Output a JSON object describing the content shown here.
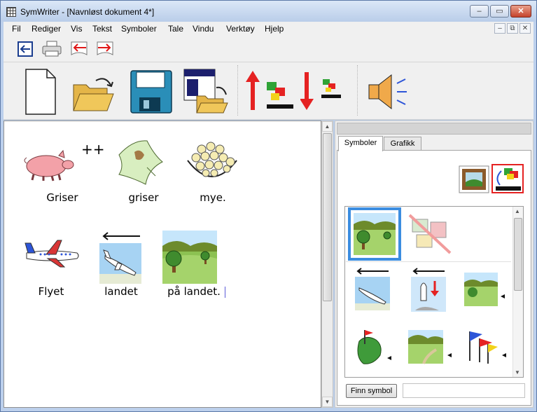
{
  "window": {
    "title": "SymWriter - [Navnløst dokument 4*]",
    "minimize": "–",
    "maximize": "▭",
    "close": "✕"
  },
  "menu": {
    "items": [
      "Fil",
      "Rediger",
      "Vis",
      "Tekst",
      "Symboler",
      "Tale",
      "Vindu",
      "Verktøy",
      "Hjelp"
    ],
    "mdi_min": "–",
    "mdi_restore": "⧉",
    "mdi_close": "✕"
  },
  "toolbar_small": {
    "icons": [
      "exit-icon",
      "print-icon",
      "undo-icon",
      "redo-icon"
    ]
  },
  "toolbar_large": {
    "icons": [
      "new-document-icon",
      "open-folder-icon",
      "save-disk-icon",
      "open-template-icon",
      "symbol-up-icon",
      "symbol-down-icon",
      "speaker-icon"
    ]
  },
  "document": {
    "words": [
      {
        "text": "Griser",
        "symbol": "pig-plural"
      },
      {
        "text": "griser",
        "symbol": "messy-cloth"
      },
      {
        "text": "mye.",
        "symbol": "many-balls"
      },
      {
        "text": "Flyet",
        "symbol": "airplane"
      },
      {
        "text": "landet",
        "symbol": "plane-landing"
      },
      {
        "text": "på landet.",
        "symbol": "countryside"
      }
    ]
  },
  "panel": {
    "tabs": [
      "Symboler",
      "Grafikk"
    ],
    "active_tab": "Symboler",
    "find_button": "Finn symbol",
    "find_value": "",
    "symbols": [
      "countryside-selected",
      "no-picture",
      "plane-landing",
      "rocket-landing",
      "countryside-more",
      "land-flag",
      "path-landscape",
      "flags"
    ],
    "colors": {
      "selection": "#3b8de0",
      "accent_red": "#e52222"
    }
  }
}
